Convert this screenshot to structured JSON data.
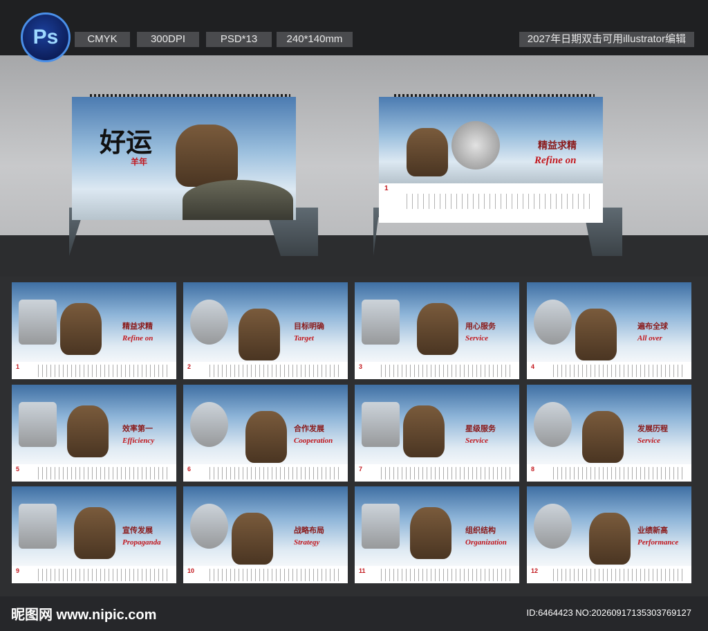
{
  "header": {
    "app_icon_label": "Ps",
    "tags": [
      "CMYK",
      "300DPI",
      "PSD*13",
      "240*140mm"
    ],
    "note": "2027年日期双击可用illustrator编辑"
  },
  "showcase": {
    "left_calendar": {
      "title": "好运",
      "subtitle": "羊年"
    },
    "right_calendar": {
      "title_cn": "精益求精",
      "title_en": "Refine on",
      "month": "1"
    }
  },
  "months": [
    {
      "num": "1",
      "cn": "精益求精",
      "en": "Refine on"
    },
    {
      "num": "2",
      "cn": "目标明确",
      "en": "Target"
    },
    {
      "num": "3",
      "cn": "用心服务",
      "en": "Service"
    },
    {
      "num": "4",
      "cn": "遍布全球",
      "en": "All over"
    },
    {
      "num": "5",
      "cn": "效率第一",
      "en": "Efficiency"
    },
    {
      "num": "6",
      "cn": "合作发展",
      "en": "Cooperation"
    },
    {
      "num": "7",
      "cn": "星级服务",
      "en": "Service"
    },
    {
      "num": "8",
      "cn": "发展历程",
      "en": "Service"
    },
    {
      "num": "9",
      "cn": "宣传发展",
      "en": "Propaganda"
    },
    {
      "num": "10",
      "cn": "战略布局",
      "en": "Strategy"
    },
    {
      "num": "11",
      "cn": "组织结构",
      "en": "Organization"
    },
    {
      "num": "12",
      "cn": "业绩新高",
      "en": "Performance"
    }
  ],
  "footer": {
    "logo": "昵图网 www.nipic.com",
    "id": "ID:6464423 NO:20260917135303769127"
  }
}
